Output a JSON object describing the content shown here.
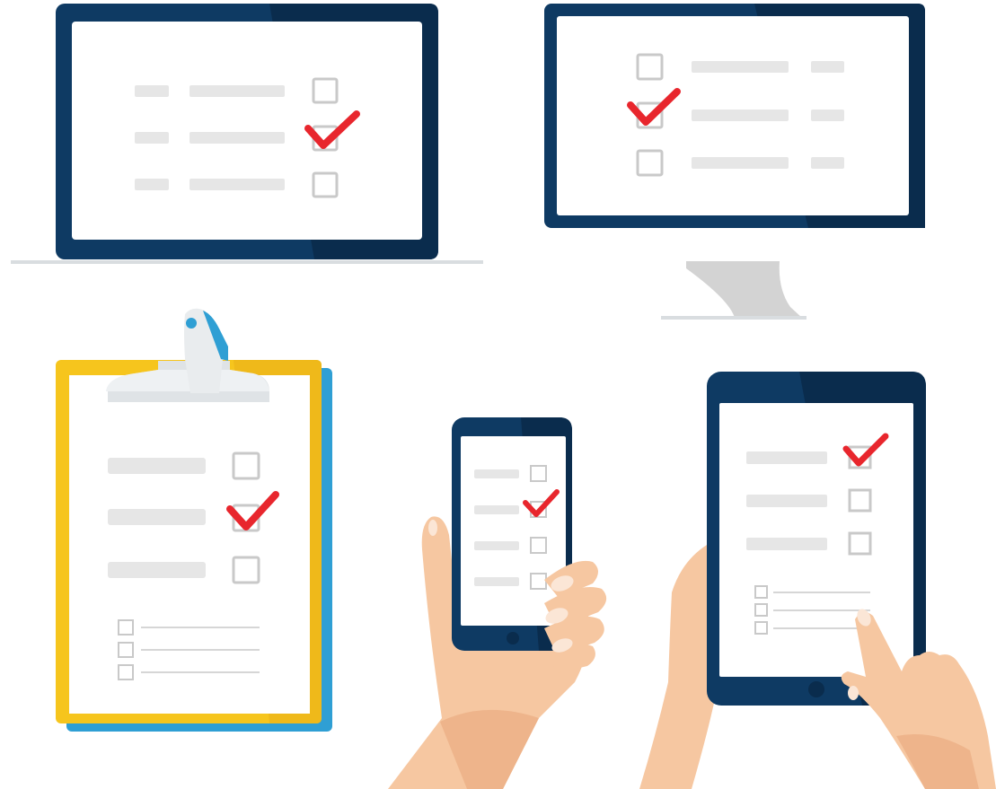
{
  "illustration": {
    "devices": [
      "laptop",
      "desktop-monitor",
      "clipboard",
      "smartphone",
      "tablet"
    ],
    "icons": [
      "checkmark-icon",
      "checkbox-icon",
      "hand-icon"
    ]
  },
  "colors": {
    "frame_navy": "#0e3a63",
    "frame_navy_dark": "#0a2c4d",
    "screen": "#ffffff",
    "placeholder_gray": "#e6e6e6",
    "checkbox_gray": "#c9c9c9",
    "checkmark_red": "#e8262d",
    "clipboard_yellow": "#f6c51d",
    "clipboard_blue": "#2f9fd4",
    "clip_light": "#eef1f3",
    "skin": "#f6c7a1",
    "skin_shadow": "#eeb48b",
    "nail": "#fbe6d6",
    "stand_gray": "#d3d3d3"
  },
  "checklists": {
    "laptop": {
      "rows": 3,
      "checked": [
        false,
        true,
        false
      ]
    },
    "monitor": {
      "rows": 3,
      "checked": [
        false,
        true,
        false
      ]
    },
    "clipboard": {
      "rows": 3,
      "checked": [
        false,
        true,
        false
      ],
      "sub_rows": 3
    },
    "phone": {
      "rows": 4,
      "checked": [
        false,
        true,
        false,
        false
      ]
    },
    "tablet": {
      "rows": 3,
      "checked": [
        true,
        false,
        false
      ],
      "sub_rows": 3
    }
  }
}
